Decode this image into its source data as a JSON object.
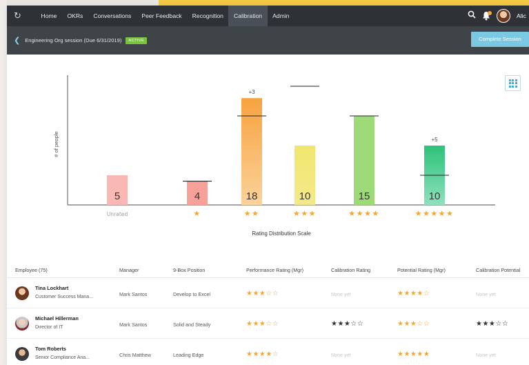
{
  "nav": {
    "items": [
      "Home",
      "OKRs",
      "Conversations",
      "Peer Feedback",
      "Recognition",
      "Calibration",
      "Admin"
    ],
    "active": "Calibration",
    "user_name": "Alic"
  },
  "session": {
    "title": "Engineering Org session",
    "due": "(Due 6/31/2019)",
    "status": "ACTIVE",
    "complete_label": "Complete Session"
  },
  "chart_data": {
    "type": "bar",
    "title": "",
    "ylabel": "# of people",
    "xlabel": "Rating Distribution Scale",
    "categories": [
      "Unrated",
      "1 star",
      "2 stars",
      "3 stars",
      "4 stars",
      "5 stars"
    ],
    "category_ticks": [
      "Unrated",
      "★",
      "★★",
      "★★★",
      "★★★★",
      "★★★★★"
    ],
    "values": [
      5,
      4,
      18,
      10,
      15,
      10
    ],
    "target_lines": [
      null,
      4,
      15,
      20,
      15,
      5
    ],
    "annotations": [
      null,
      null,
      "+3",
      null,
      null,
      "+5"
    ],
    "colors": [
      "#f9b8b3",
      "#f6a09a",
      "#f7a23f",
      "#f4e98a",
      "#9edb78",
      "#2ec27a"
    ],
    "bar_top_colors": [
      "#f9b8b3",
      "#f6a09a",
      "#f7a23f",
      "#f0e66e",
      "#9edb78",
      "#2ec27a"
    ],
    "bar_bottom_colors": [
      "#f9b8b3",
      "#f6a09a",
      "#fbd29a",
      "#f4e98a",
      "#9edb78",
      "#8fe0bd"
    ],
    "tick_colors": [
      "#999999",
      "#f2a637",
      "#f2a637",
      "#f2a637",
      "#f2a637",
      "#f2a637"
    ],
    "ylim": [
      0,
      20
    ],
    "grid": false
  },
  "table": {
    "headers": [
      "Employee (75)",
      "Manager",
      "9-Box Position",
      "Performance Rating (Mgr)",
      "Calibration Rating",
      "Potential Rating (Mgr)",
      "Calibration Potential"
    ],
    "rows": [
      {
        "name": "Tina Lockhart",
        "title": "Customer Success Mana...",
        "manager": "Mark Santos",
        "position": "Develop to Excel",
        "perf": {
          "text": "★★★☆☆",
          "style": "orange"
        },
        "calib": {
          "text": "None yet",
          "style": "none"
        },
        "pot": {
          "text": "★★★★☆",
          "style": "orange"
        },
        "calib_pot": {
          "text": "None yet",
          "style": "none"
        }
      },
      {
        "name": "Michael Hillerman",
        "title": "Director of IT",
        "manager": "Mark Santos",
        "position": "Solid and Steady",
        "perf": {
          "text": "★★★☆☆",
          "style": "orange"
        },
        "calib": {
          "text": "★★★☆☆",
          "style": "gray"
        },
        "pot": {
          "text": "★★★☆☆",
          "style": "orange"
        },
        "calib_pot": {
          "text": "★★★☆☆",
          "style": "gray"
        }
      },
      {
        "name": "Tom Roberts",
        "title": "Senior Compliance Ana...",
        "manager": "Chris Matthew",
        "position": "Leading Edge",
        "perf": {
          "text": "★★★★☆",
          "style": "orange"
        },
        "calib": {
          "text": "None yet",
          "style": "none"
        },
        "pot": {
          "text": "★★★★★",
          "style": "orange"
        },
        "calib_pot": {
          "text": "None yet",
          "style": "none"
        }
      }
    ]
  }
}
